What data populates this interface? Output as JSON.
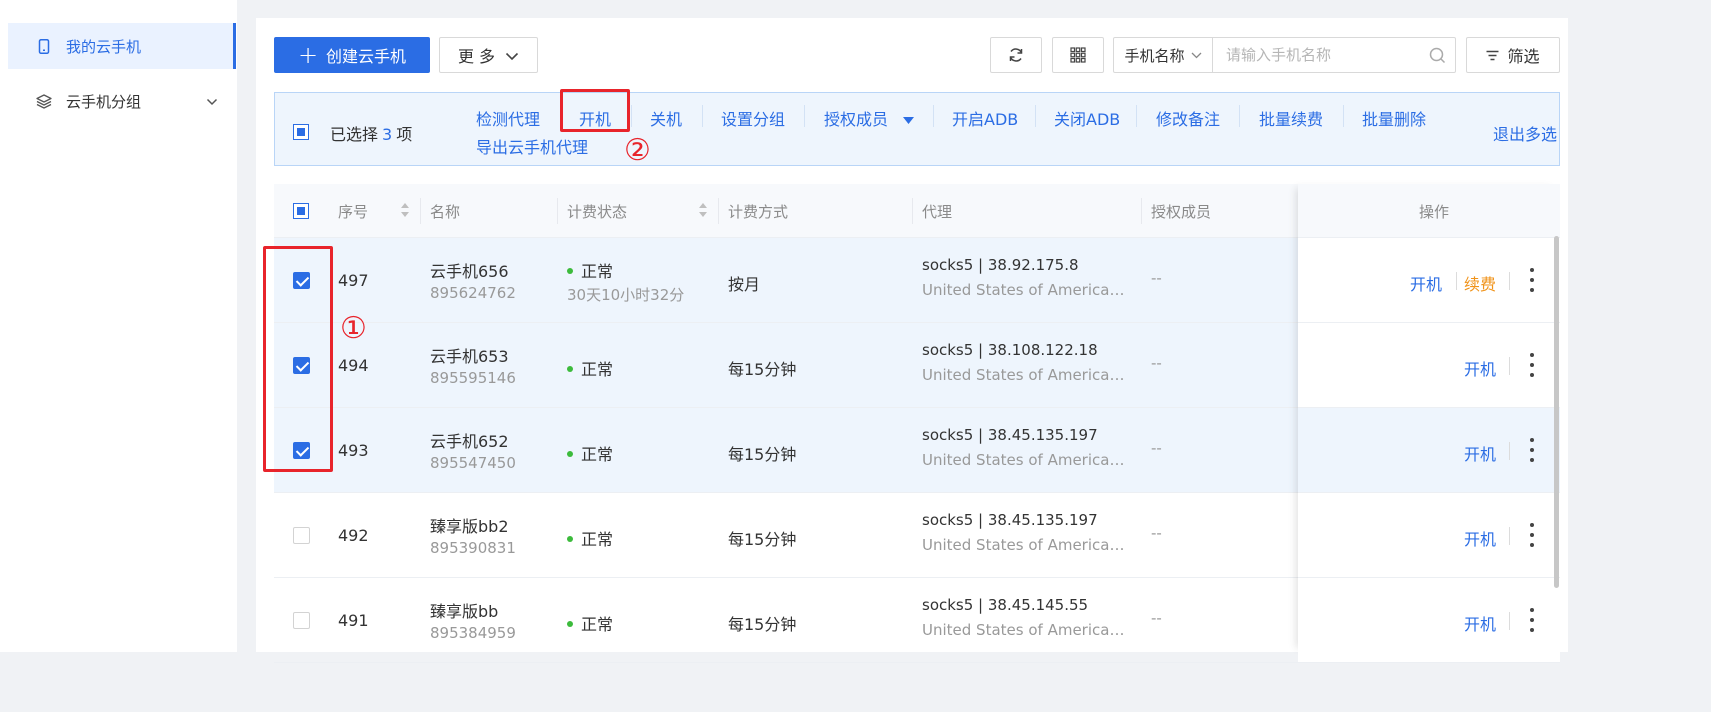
{
  "sidebar": {
    "items": [
      {
        "label": "我的云手机",
        "icon": "phone-icon",
        "active": true
      },
      {
        "label": "云手机分组",
        "icon": "layers-icon",
        "active": false
      }
    ]
  },
  "toolbar": {
    "create_label": "创建云手机",
    "more_label": "更 多",
    "search_type": "手机名称",
    "search_placeholder": "请输入手机名称",
    "filter_label": "筛选"
  },
  "batch": {
    "selected_prefix": "已选择",
    "selected_count": "3",
    "selected_suffix": "项",
    "actions": [
      "检测代理",
      "开机",
      "关机",
      "设置分组",
      "授权成员",
      "开启ADB",
      "关闭ADB",
      "修改备注",
      "批量续费",
      "批量删除"
    ],
    "export_label": "导出云手机代理",
    "exit_label": "退出多选"
  },
  "table": {
    "headers": {
      "index": "序号",
      "name": "名称",
      "billing_status": "计费状态",
      "billing_method": "计费方式",
      "proxy": "代理",
      "members": "授权成员",
      "actions": "操作"
    },
    "rows": [
      {
        "checked": true,
        "index": "497",
        "name": "云手机656",
        "id": "895624762",
        "status": "正常",
        "remaining": "30天10小时32分",
        "method": "按月",
        "proxy": "socks5 | 38.92.175.8",
        "location": "United States of America,M...",
        "members": "--",
        "power": "开机",
        "renew": "续费"
      },
      {
        "checked": true,
        "index": "494",
        "name": "云手机653",
        "id": "895595146",
        "status": "正常",
        "remaining": "",
        "method": "每15分钟",
        "proxy": "socks5 | 38.108.122.18",
        "location": "United States of America,N...",
        "members": "--",
        "power": "开机",
        "renew": ""
      },
      {
        "checked": true,
        "index": "493",
        "name": "云手机652",
        "id": "895547450",
        "status": "正常",
        "remaining": "",
        "method": "每15分钟",
        "proxy": "socks5 | 38.45.135.197",
        "location": "United States of America,W...",
        "members": "--",
        "power": "开机",
        "renew": ""
      },
      {
        "checked": false,
        "index": "492",
        "name": "臻享版bb2",
        "id": "895390831",
        "status": "正常",
        "remaining": "",
        "method": "每15分钟",
        "proxy": "socks5 | 38.45.135.197",
        "location": "United States of America,W...",
        "members": "--",
        "power": "开机",
        "renew": ""
      },
      {
        "checked": false,
        "index": "491",
        "name": "臻享版bb",
        "id": "895384959",
        "status": "正常",
        "remaining": "",
        "method": "每15分钟",
        "proxy": "socks5 | 38.45.145.55",
        "location": "United States of America,W...",
        "members": "--",
        "power": "开机",
        "renew": ""
      }
    ]
  },
  "annotations": {
    "first": "①",
    "second": "②"
  },
  "colors": {
    "accent": "#2b6de4",
    "warning": "#f0931a",
    "status_ok": "#3cbb3c",
    "annotation": "#e8242b"
  }
}
